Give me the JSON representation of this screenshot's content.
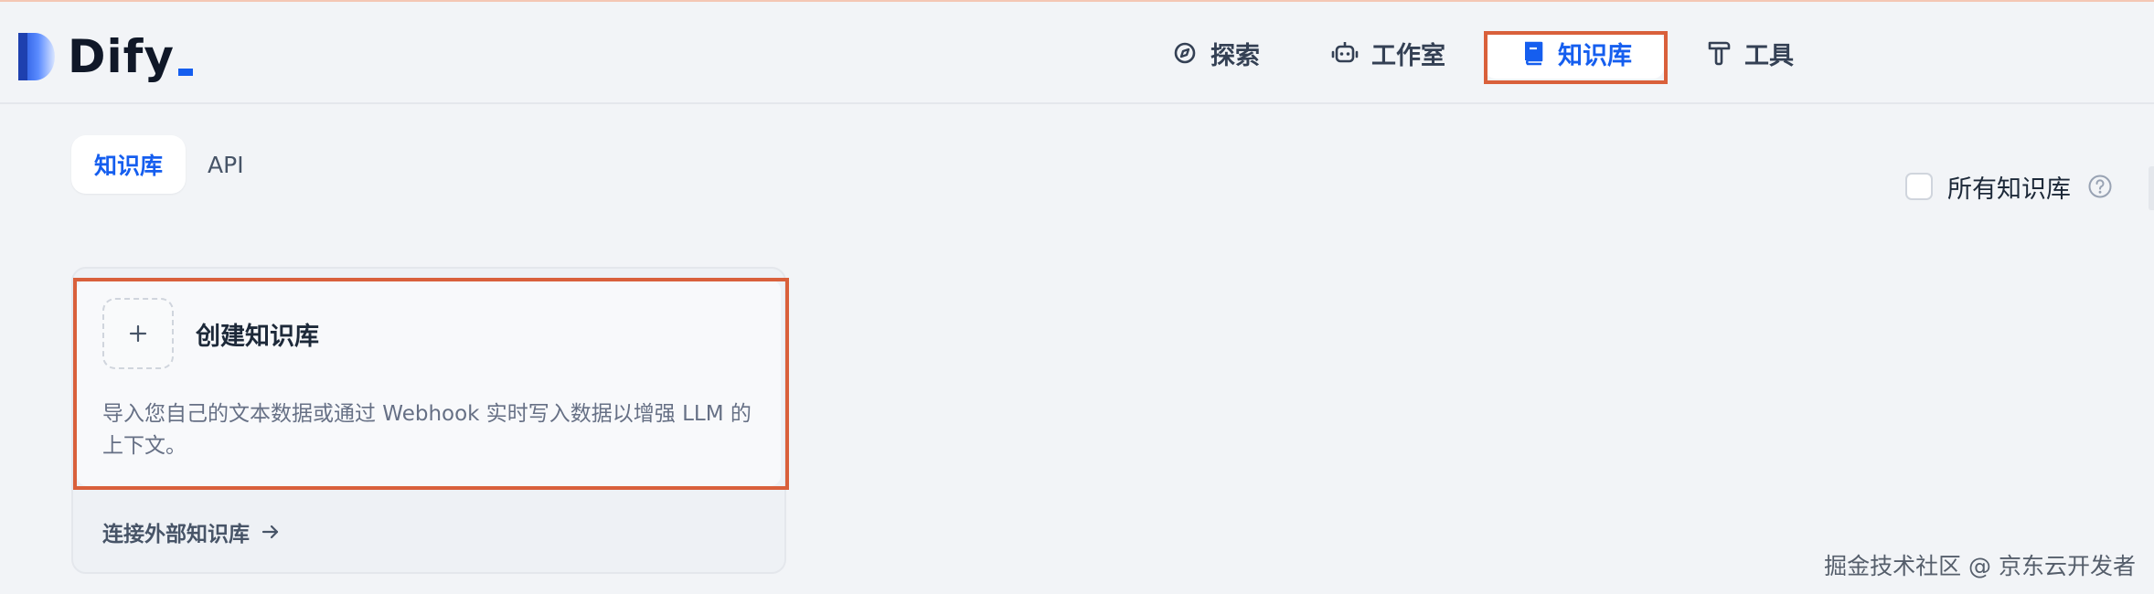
{
  "app": {
    "name": "Dify"
  },
  "nav": {
    "items": [
      {
        "label": "探索",
        "icon": "compass-icon"
      },
      {
        "label": "工作室",
        "icon": "robot-icon"
      },
      {
        "label": "知识库",
        "icon": "book-icon",
        "active": true
      },
      {
        "label": "工具",
        "icon": "hammer-icon"
      }
    ]
  },
  "tabs": [
    {
      "label": "知识库",
      "active": true
    },
    {
      "label": "API",
      "active": false
    }
  ],
  "filter": {
    "all_knowledge_label": "所有知识库",
    "checked": false
  },
  "create_card": {
    "title": "创建知识库",
    "description": "导入您自己的文本数据或通过 Webhook 实时写入数据以增强 LLM 的上下文。",
    "connect_link": "连接外部知识库"
  },
  "watermark": "掘金技术社区 @ 京东云开发者",
  "colors": {
    "accent": "#155eef",
    "highlight": "#d9603b",
    "background": "#f2f4f7"
  }
}
